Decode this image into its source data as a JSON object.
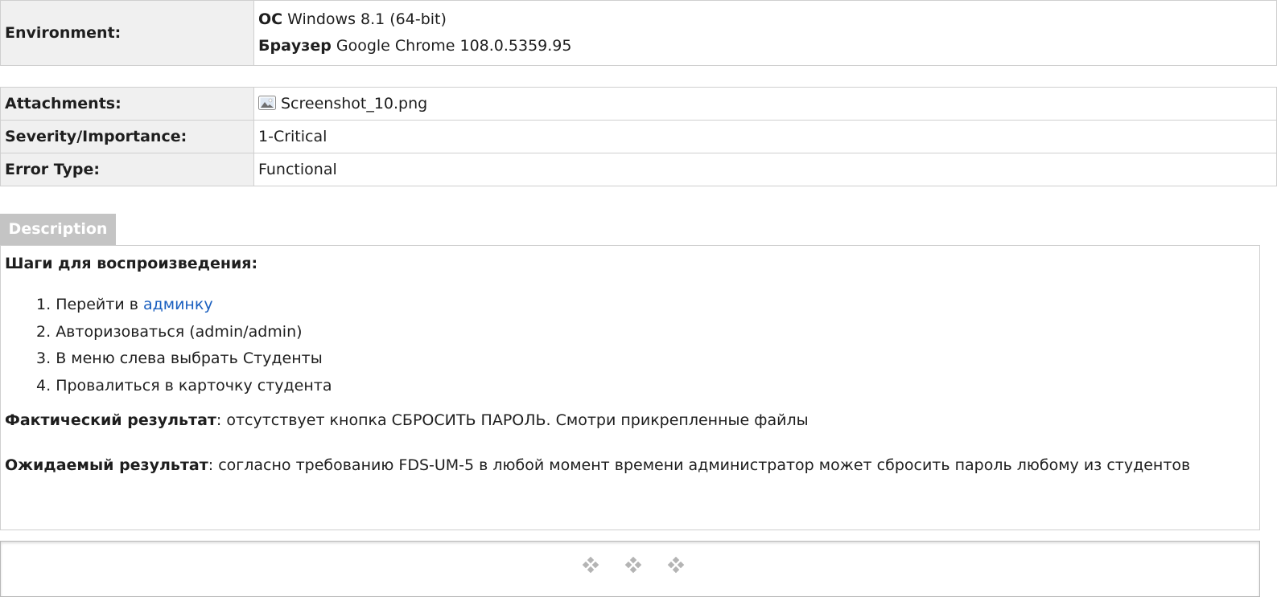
{
  "environment": {
    "label": "Environment:",
    "os_label": "ОС",
    "os_value": "Windows 8.1 (64-bit)",
    "browser_label": "Браузер",
    "browser_value": "Google Chrome 108.0.5359.95"
  },
  "details": {
    "attachments_label": "Attachments:",
    "attachment_icon": "image-icon",
    "attachment_file": "Screenshot_10.png",
    "severity_label": "Severity/Importance:",
    "severity_value": "1-Critical",
    "error_type_label": "Error Type:",
    "error_type_value": "Functional"
  },
  "description": {
    "tab_label": "Description",
    "steps_title": "Шаги для воспроизведения:",
    "steps": [
      {
        "num": "1.",
        "text": "Перейти в ",
        "link": "админку"
      },
      {
        "num": "2.",
        "text": " Авторизоваться (admin/admin)"
      },
      {
        "num": "3.",
        "text": "В меню слева выбрать Студенты"
      },
      {
        "num": "4.",
        "text": "Провалиться в карточку студента"
      }
    ],
    "actual_label": "Фактический результат",
    "actual_text": ": отсутствует кнопка СБРОСИТЬ ПАРОЛЬ. Смотри прикрепленные файлы",
    "expected_label": "Ожидаемый результат",
    "expected_text": ": согласно требованию FDS-UM-5 в любой момент времени администратор может сбросить пароль любому из студентов"
  },
  "footer": {
    "ornament_icon": "diamond-ornament-icon"
  },
  "colors": {
    "label_bg": "#f0f0f0",
    "border": "#cfcfcf",
    "tab_bg": "#c4c4c4",
    "link": "#1a5fbf"
  }
}
